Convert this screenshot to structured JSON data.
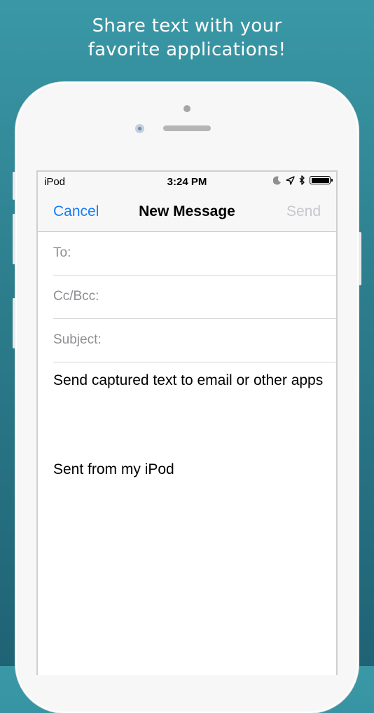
{
  "headline": {
    "line1": "Share text with your",
    "line2": "favorite applications!"
  },
  "status_bar": {
    "carrier": "iPod",
    "time": "3:24 PM",
    "icons": [
      "moon-icon",
      "location-arrow-icon",
      "bluetooth-icon",
      "battery-icon"
    ]
  },
  "nav": {
    "cancel": "Cancel",
    "title": "New Message",
    "send": "Send"
  },
  "fields": {
    "to_label": "To:",
    "cc_label": "Cc/Bcc:",
    "subject_label": "Subject:"
  },
  "message": {
    "body": "Send captured text to email or other apps",
    "signature": "Sent from my iPod"
  },
  "colors": {
    "accent": "#157efb",
    "disabled": "#c7c7cc",
    "background_top": "#3a98a6",
    "background_bottom": "#1f6375"
  }
}
